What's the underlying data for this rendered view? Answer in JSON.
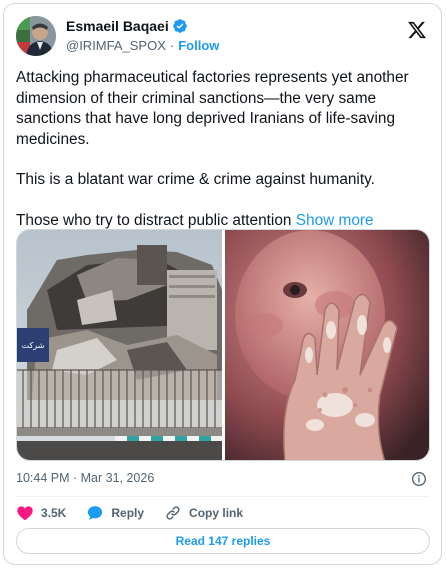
{
  "author": {
    "name": "Esmaeil Baqaei",
    "handle": "@IRIMFA_SPOX",
    "separator": "·",
    "follow_label": "Follow"
  },
  "tweet": {
    "paragraphs": [
      "Attacking pharmaceutical factories represents yet another dimension of their criminal sanctions—the very same sanctions that have long deprived Iranians of life-saving medicines.",
      "This is a blatant war crime & crime against humanity."
    ],
    "last_line": "Those who try to distract public attention",
    "show_more_label": "Show more"
  },
  "media": {
    "left_sign_text": "شرکت"
  },
  "meta": {
    "timestamp": "10:44 PM · Mar 31, 2026"
  },
  "actions": {
    "likes": "3.5K",
    "reply_label": "Reply",
    "copy_link_label": "Copy link"
  },
  "read_replies_label": "Read 147 replies",
  "colors": {
    "accent": "#1d9bf0",
    "like": "#f91880",
    "text": "#0f1419",
    "muted": "#536471"
  },
  "icons": [
    "verified-badge-icon",
    "x-logo-icon",
    "info-icon",
    "heart-icon",
    "reply-bubble-icon",
    "link-icon"
  ]
}
